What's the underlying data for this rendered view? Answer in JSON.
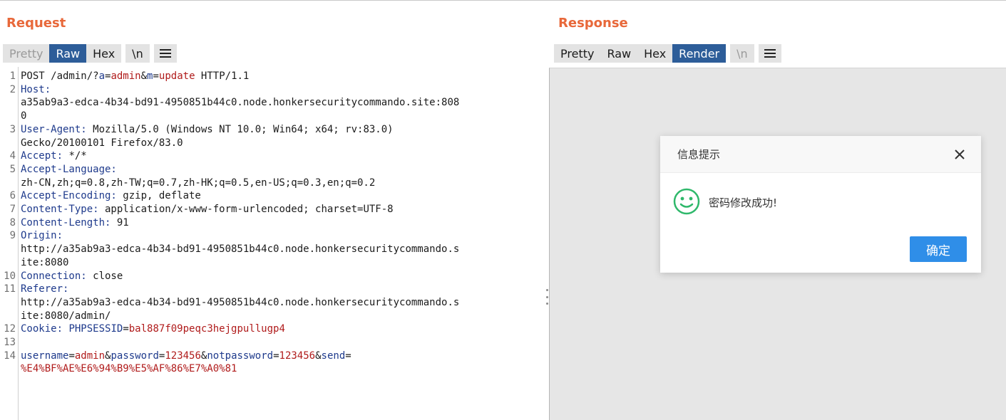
{
  "request": {
    "title": "Request",
    "tabs": [
      {
        "label": "Pretty"
      },
      {
        "label": "Raw"
      },
      {
        "label": "Hex"
      },
      {
        "label": "\\n"
      }
    ],
    "lines": [
      {
        "num": "1",
        "text": "POST /admin/?a=admin&m=update HTTP/1.1"
      },
      {
        "num": "2",
        "text": "Host:"
      },
      {
        "num": "",
        "text": "a35ab9a3-edca-4b34-bd91-4950851b44c0.node.honkersecuritycommando.site:808"
      },
      {
        "num": "",
        "text": "0"
      },
      {
        "num": "3",
        "text": "User-Agent: Mozilla/5.0 (Windows NT 10.0; Win64; x64; rv:83.0)"
      },
      {
        "num": "",
        "text": "Gecko/20100101 Firefox/83.0"
      },
      {
        "num": "4",
        "text": "Accept: */*"
      },
      {
        "num": "5",
        "text": "Accept-Language:"
      },
      {
        "num": "",
        "text": "zh-CN,zh;q=0.8,zh-TW;q=0.7,zh-HK;q=0.5,en-US;q=0.3,en;q=0.2"
      },
      {
        "num": "6",
        "text": "Accept-Encoding: gzip, deflate"
      },
      {
        "num": "7",
        "text": "Content-Type: application/x-www-form-urlencoded; charset=UTF-8"
      },
      {
        "num": "8",
        "text": "Content-Length: 91"
      },
      {
        "num": "9",
        "text": "Origin:"
      },
      {
        "num": "",
        "text": "http://a35ab9a3-edca-4b34-bd91-4950851b44c0.node.honkersecuritycommando.s"
      },
      {
        "num": "",
        "text": "ite:8080"
      },
      {
        "num": "10",
        "text": "Connection: close"
      },
      {
        "num": "11",
        "text": "Referer:"
      },
      {
        "num": "",
        "text": "http://a35ab9a3-edca-4b34-bd91-4950851b44c0.node.honkersecuritycommando.s"
      },
      {
        "num": "",
        "text": "ite:8080/admin/"
      },
      {
        "num": "12",
        "text": "Cookie: PHPSESSID=bal887f09peqc3hejgpullugp4"
      },
      {
        "num": "13",
        "text": ""
      },
      {
        "num": "14",
        "text": "username=admin&password=123456&notpassword=123456&send="
      },
      {
        "num": "",
        "text": "%E4%BF%AE%E6%94%B9%E5%AF%86%E7%A0%81"
      }
    ]
  },
  "response": {
    "title": "Response",
    "tabs": [
      {
        "label": "Pretty"
      },
      {
        "label": "Raw"
      },
      {
        "label": "Hex"
      },
      {
        "label": "Render"
      },
      {
        "label": "\\n"
      }
    ],
    "dialog": {
      "title": "信息提示",
      "message": "密码修改成功!",
      "ok_label": "确定"
    }
  },
  "colors": {
    "title_orange": "#e8683a",
    "active_tab": "#2d5d99",
    "header_key": "#1e3a8c",
    "param_value": "#b01b1b",
    "ok_button": "#2f8ee8",
    "smiley_green": "#2fb86b"
  }
}
